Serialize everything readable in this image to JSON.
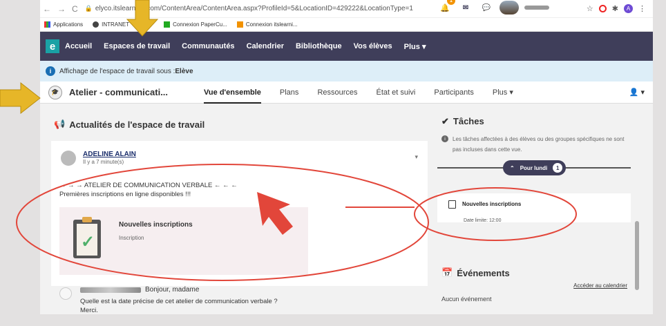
{
  "browser": {
    "url": "elyco.itslearning.com/ContentArea/ContentArea.aspx?ProfileId=5&LocationID=429222&LocationType=1",
    "nav_back": "←",
    "nav_forward": "→",
    "nav_reload": "C",
    "ext_star": "☆",
    "ext_puzzle": "✱",
    "profile_initial": "A"
  },
  "bookmarks": {
    "apps": "Applications",
    "intranet": "INTRANET",
    "papercut": "Connexion PaperCu...",
    "itslearning": "Connexion itslearni..."
  },
  "appnav": {
    "logo": "e",
    "items": [
      "Accueil",
      "Espaces de travail",
      "Communautés",
      "Calendrier",
      "Bibliothèque",
      "Vos élèves",
      "Plus ▾"
    ],
    "notif_count": "1"
  },
  "infobar": {
    "text": "Affichage de l'espace de travail sous : ",
    "role": "Elève"
  },
  "workspace": {
    "title": "Atelier - communicati...",
    "tabs": [
      "Vue d'ensemble",
      "Plans",
      "Ressources",
      "État et suivi",
      "Participants",
      "Plus ▾"
    ],
    "user_menu": "👤 ▾"
  },
  "news": {
    "heading": "Actualités de l'espace de travail",
    "post": {
      "author": "ADELINE ALAIN",
      "time": "Il y a 7 minute(s)",
      "line1": "→ → → ATELIER DE COMMUNICATION VERBALE ← ← ←",
      "line2": "Premières inscriptions en ligne disponibles !!!",
      "card_title": "Nouvelles inscriptions",
      "card_sub": "Inscription"
    },
    "comment": {
      "greeting": "Bonjour, madame",
      "text": "Quelle est la date précise de cet atelier de communication verbale ?",
      "text2": "Merci."
    }
  },
  "tasks": {
    "heading": "Tâches",
    "note": "Les tâches affectées à des élèves ou des groupes spécifiques ne sont pas incluses dans cette vue.",
    "pill_label": "Pour lundi",
    "pill_count": "1",
    "task_name": "Nouvelles inscriptions",
    "task_date": "Date limite: 12:00"
  },
  "events": {
    "heading": "Événements",
    "calendar_link": "Accéder au calendrier",
    "none": "Aucun événement"
  },
  "colors": {
    "nav_bg": "#3f3e5a",
    "annotation_red": "#e2463a",
    "arrow_yellow": "#e6b628",
    "info_bg": "#ddeef8"
  }
}
